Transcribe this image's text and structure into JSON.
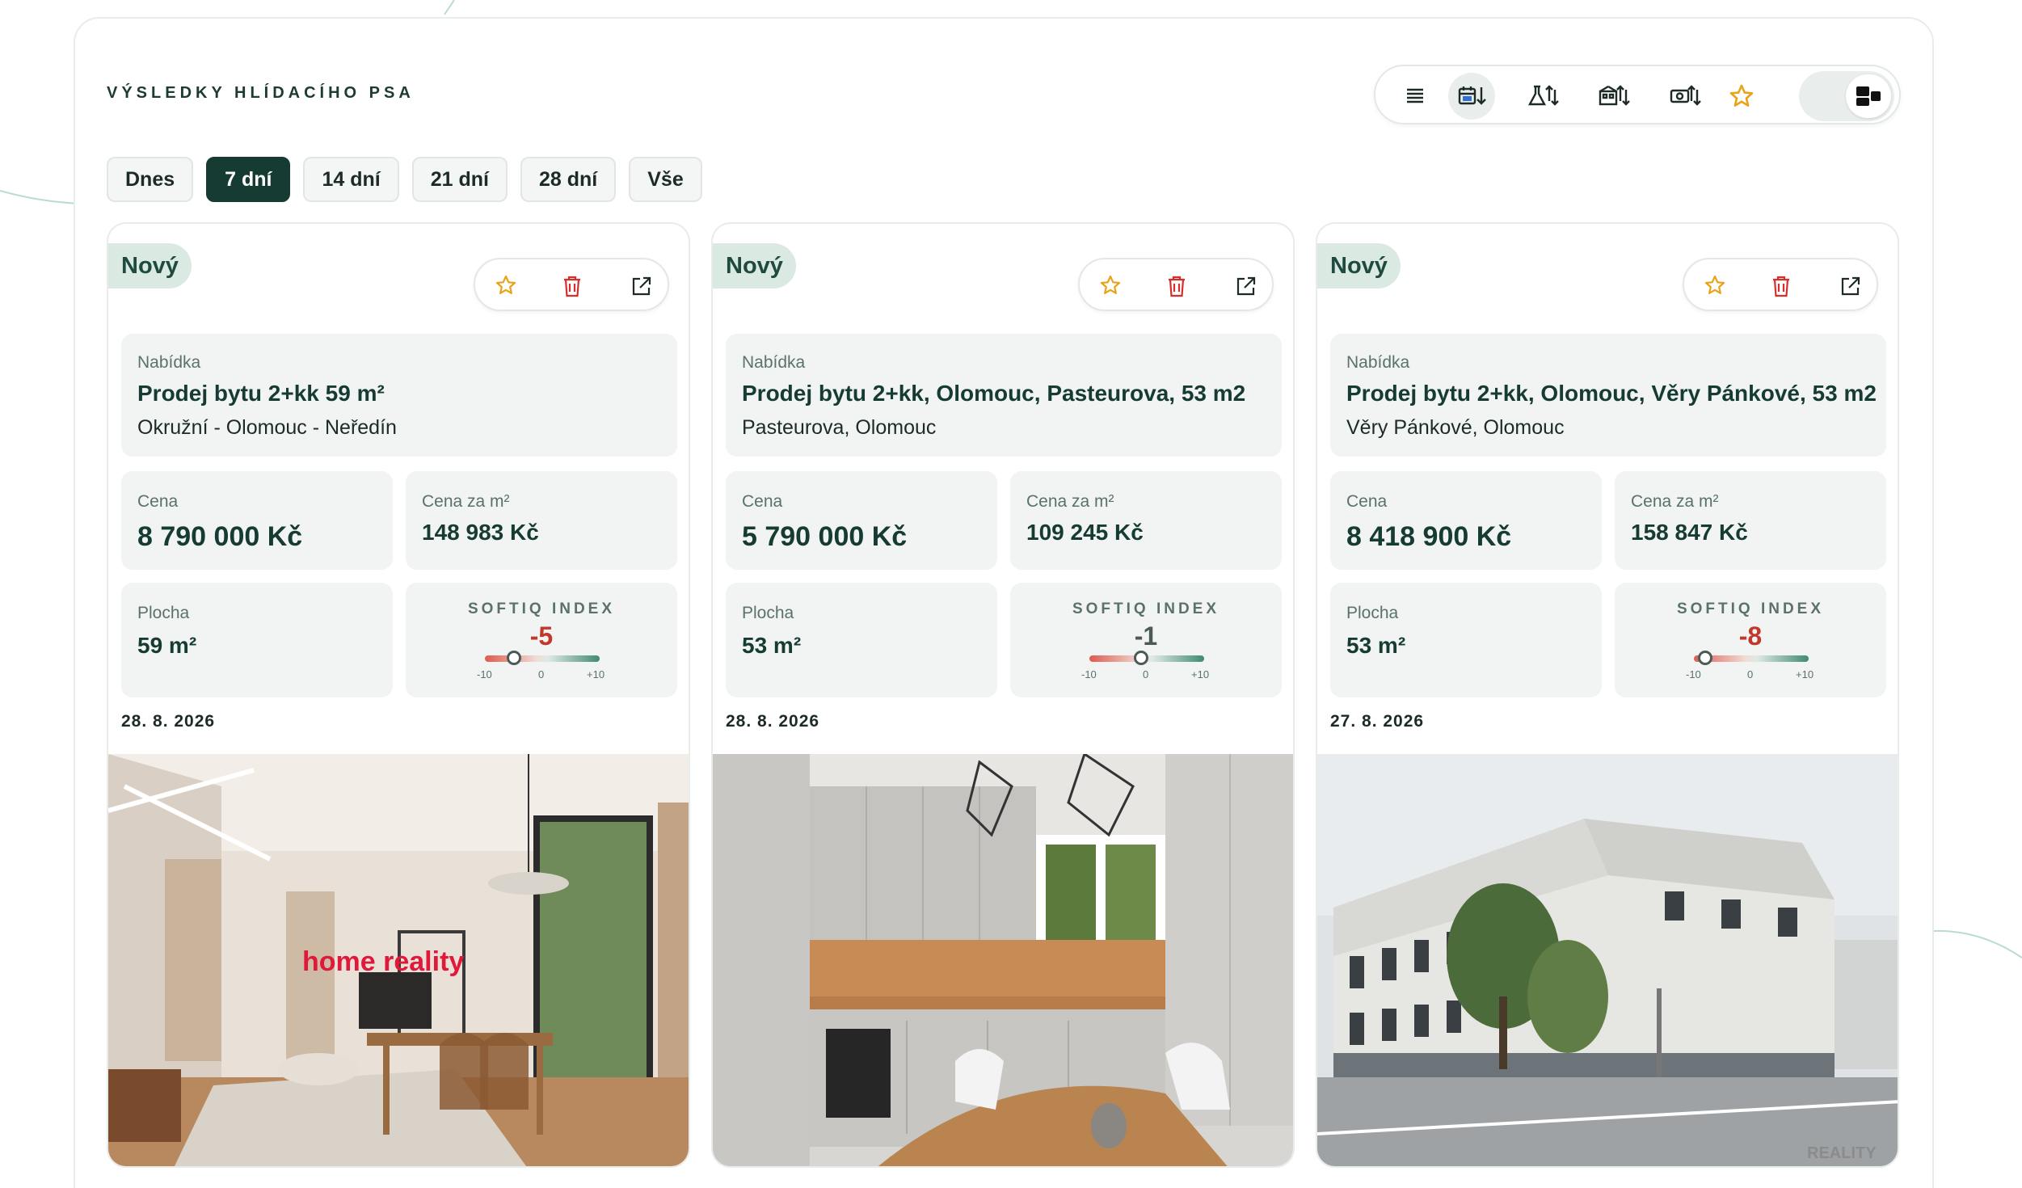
{
  "header": {
    "title": "VÝSLEDKY HLÍDACÍHO PSA"
  },
  "toolbar": {
    "buttons": [
      {
        "icon": "list-icon"
      },
      {
        "icon": "calendar-sort-icon"
      },
      {
        "icon": "flask-sort-icon"
      },
      {
        "icon": "building-sort-icon"
      },
      {
        "icon": "money-sort-icon"
      },
      {
        "icon": "star-icon"
      }
    ],
    "view_toggle": "grid-view-icon"
  },
  "filters": [
    {
      "label": "Dnes",
      "active": false
    },
    {
      "label": "7 dní",
      "active": true
    },
    {
      "label": "14 dní",
      "active": false
    },
    {
      "label": "21 dní",
      "active": false
    },
    {
      "label": "28 dní",
      "active": false
    },
    {
      "label": "Vše",
      "active": false
    }
  ],
  "labels": {
    "offer": "Nabídka",
    "price": "Cena",
    "price_per_m2": "Cena za m²",
    "area": "Plocha",
    "index": "SOFTIQ INDEX",
    "tick_min": "-10",
    "tick_mid": "0",
    "tick_max": "+10"
  },
  "cards": [
    {
      "badge": "Nový",
      "title": "Prodej bytu 2+kk 59 m²",
      "address": "Okružní - Olomouc - Neředín",
      "price": "8 790 000 Kč",
      "price_per_m2": "148 983 Kč",
      "area": "59 m²",
      "index": "-5",
      "index_color": "#c0392b",
      "date": "28. 8. 2026",
      "photo_watermark": "home reality"
    },
    {
      "badge": "Nový",
      "title": "Prodej bytu 2+kk, Olomouc, Pasteurova, 53 m2",
      "address": "Pasteurova, Olomouc",
      "price": "5 790 000 Kč",
      "price_per_m2": "109 245 Kč",
      "area": "53 m²",
      "index": "-1",
      "index_color": "#4b5a56",
      "date": "28. 8. 2026",
      "photo_watermark": ""
    },
    {
      "badge": "Nový",
      "title": "Prodej bytu 2+kk, Olomouc, Věry Pánkové, 53 m2",
      "address": "Věry Pánkové, Olomouc",
      "price": "8 418 900 Kč",
      "price_per_m2": "158 847 Kč",
      "area": "53 m²",
      "index": "-8",
      "index_color": "#c0392b",
      "date": "27. 8. 2026",
      "photo_watermark": "REALITY"
    }
  ],
  "colors": {
    "accent": "#163b33",
    "badge_bg": "#dbe9e3",
    "favorite": "#e8a317",
    "delete": "#d62d2d"
  }
}
